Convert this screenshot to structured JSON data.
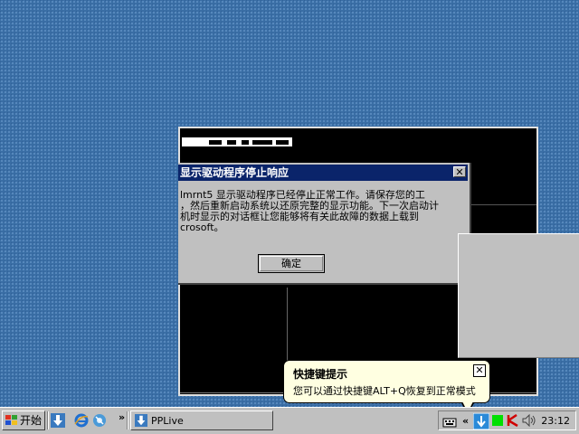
{
  "desktop": {
    "background_color": "#3a6ea5"
  },
  "error_dialog": {
    "title": "显示驱动程序停止响应",
    "message_lines": [
      "lmrnt5 显示驱动程序已经停止正常工作。请保存您的工",
      "，然后重新启动系统以还原完整的显示功能。下一次启动计",
      "机时显示的对话框让您能够将有关此故障的数据上载到",
      "crosoft。"
    ],
    "ok_label": "确定",
    "close_glyph": "✕"
  },
  "balloon": {
    "title": "快捷键提示",
    "text": "您可以通过快捷键ALT+Q恢复到正常模式",
    "close_glyph": "✕"
  },
  "taskbar": {
    "start_label": "开始",
    "quicklaunch_chevron": "»",
    "task_label": "PPLive",
    "tray_chevron": "«",
    "clock": "23:12"
  },
  "icons": [
    "windows-flag-icon",
    "pplive-download-icon",
    "ie-icon",
    "media-icon",
    "keyboard-icon",
    "network-icon",
    "green-square-icon",
    "kaspersky-icon",
    "speaker-icon"
  ],
  "colors": {
    "titlebar": "#0a246a",
    "balloon_bg": "#ffffe1",
    "chrome": "#c0c0c0"
  }
}
